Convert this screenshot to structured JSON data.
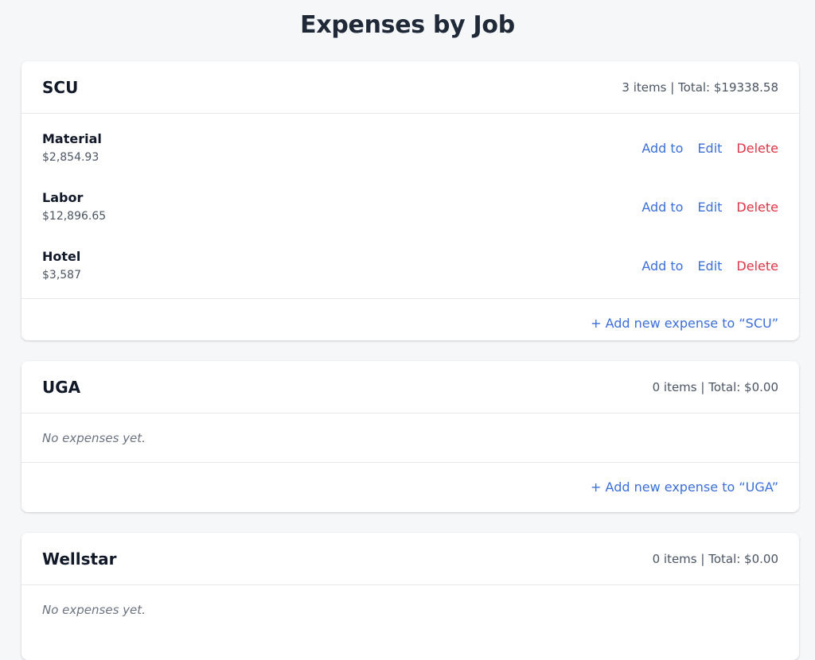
{
  "page": {
    "title": "Expenses by Job"
  },
  "jobs": [
    {
      "name": "SCU",
      "summary": "3 items | Total: $19338.58",
      "expenses": [
        {
          "name": "Material",
          "amount": "$2,854.93"
        },
        {
          "name": "Labor",
          "amount": "$12,896.65"
        },
        {
          "name": "Hotel",
          "amount": "$3,587"
        }
      ],
      "add_label": "+ Add new expense to “SCU”"
    },
    {
      "name": "UGA",
      "summary": "0 items | Total: $0.00",
      "empty_text": "No expenses yet.",
      "add_label": "+ Add new expense to “UGA”"
    },
    {
      "name": "Wellstar",
      "summary": "0 items | Total: $0.00",
      "empty_text": "No expenses yet."
    }
  ],
  "actions": {
    "add_to": "Add to",
    "edit": "Edit",
    "delete": "Delete"
  },
  "colors": {
    "link": "#3b6fd9",
    "delete": "#dc3545",
    "background": "#f6f7f9"
  }
}
